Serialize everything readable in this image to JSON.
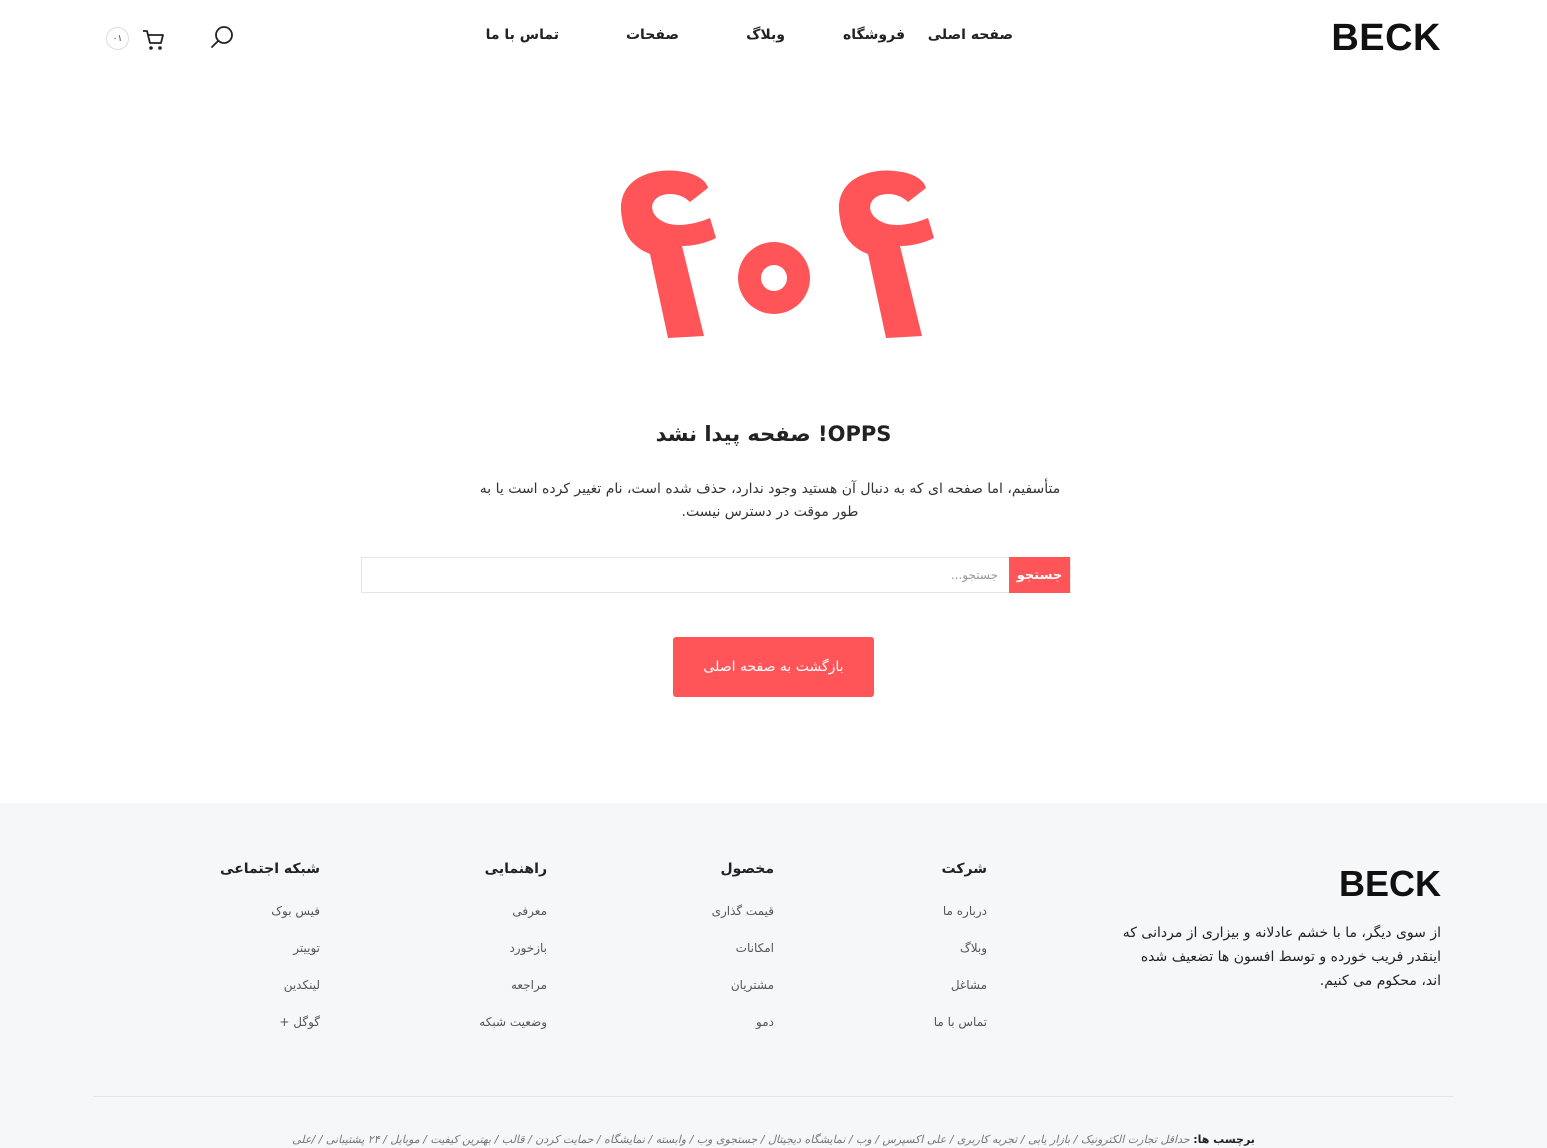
{
  "header": {
    "logo": "BECK",
    "nav": [
      "صفحه اصلی",
      "فروشگاه",
      "وبلاگ",
      "صفحات",
      "تماس با ما"
    ],
    "cart_count": "۰۱"
  },
  "main": {
    "code": "۴۰۴",
    "title": "OPPS! صفحه پیدا نشد",
    "description": "متأسفیم، اما صفحه ای که به دنبال آن هستید وجود ندارد، حذف شده است، نام تغییر کرده است یا به طور موقت در دسترس نیست.",
    "search_placeholder": "جستجو...",
    "search_button": "جستجو",
    "home_button": "بازگشت به صفحه اصلی",
    "accent_color": "#ff5558"
  },
  "footer": {
    "logo": "BECK",
    "about": "از سوی دیگر، ما با خشم عادلانه و بیزاری از مردانی که اینقدر فریب خورده و توسط افسون ها تضعیف شده اند، محکوم می کنیم.",
    "columns": [
      {
        "title": "شرکت",
        "items": [
          "درباره ما",
          "وبلاگ",
          "مشاغل",
          "تماس با ما"
        ]
      },
      {
        "title": "مخصول",
        "items": [
          "قیمت گذاری",
          "امکانات",
          "مشتریان",
          "دمو"
        ]
      },
      {
        "title": "راهنمایی",
        "items": [
          "معرفی",
          "بازخورد",
          "مراجعه",
          "وضعیت شبکه"
        ]
      },
      {
        "title": "شبکه اجتماعی",
        "items": [
          "فیس بوک",
          "توییتر",
          "لینکدین",
          "گوگل +"
        ]
      }
    ],
    "tags_label": "برچسب ها:",
    "tags": "حداقل تجارت الکترونیک / بازار یابی / تجربه کاربری / علی اکسپرس / وب / نمایشگاه دیجیتال / جستجوی وب / وابسته / نمایشگاه / حمایت کردن / قالب / بهترین کیفیت / موبایل / ۲۴ پشتیبانی / /علی"
  }
}
